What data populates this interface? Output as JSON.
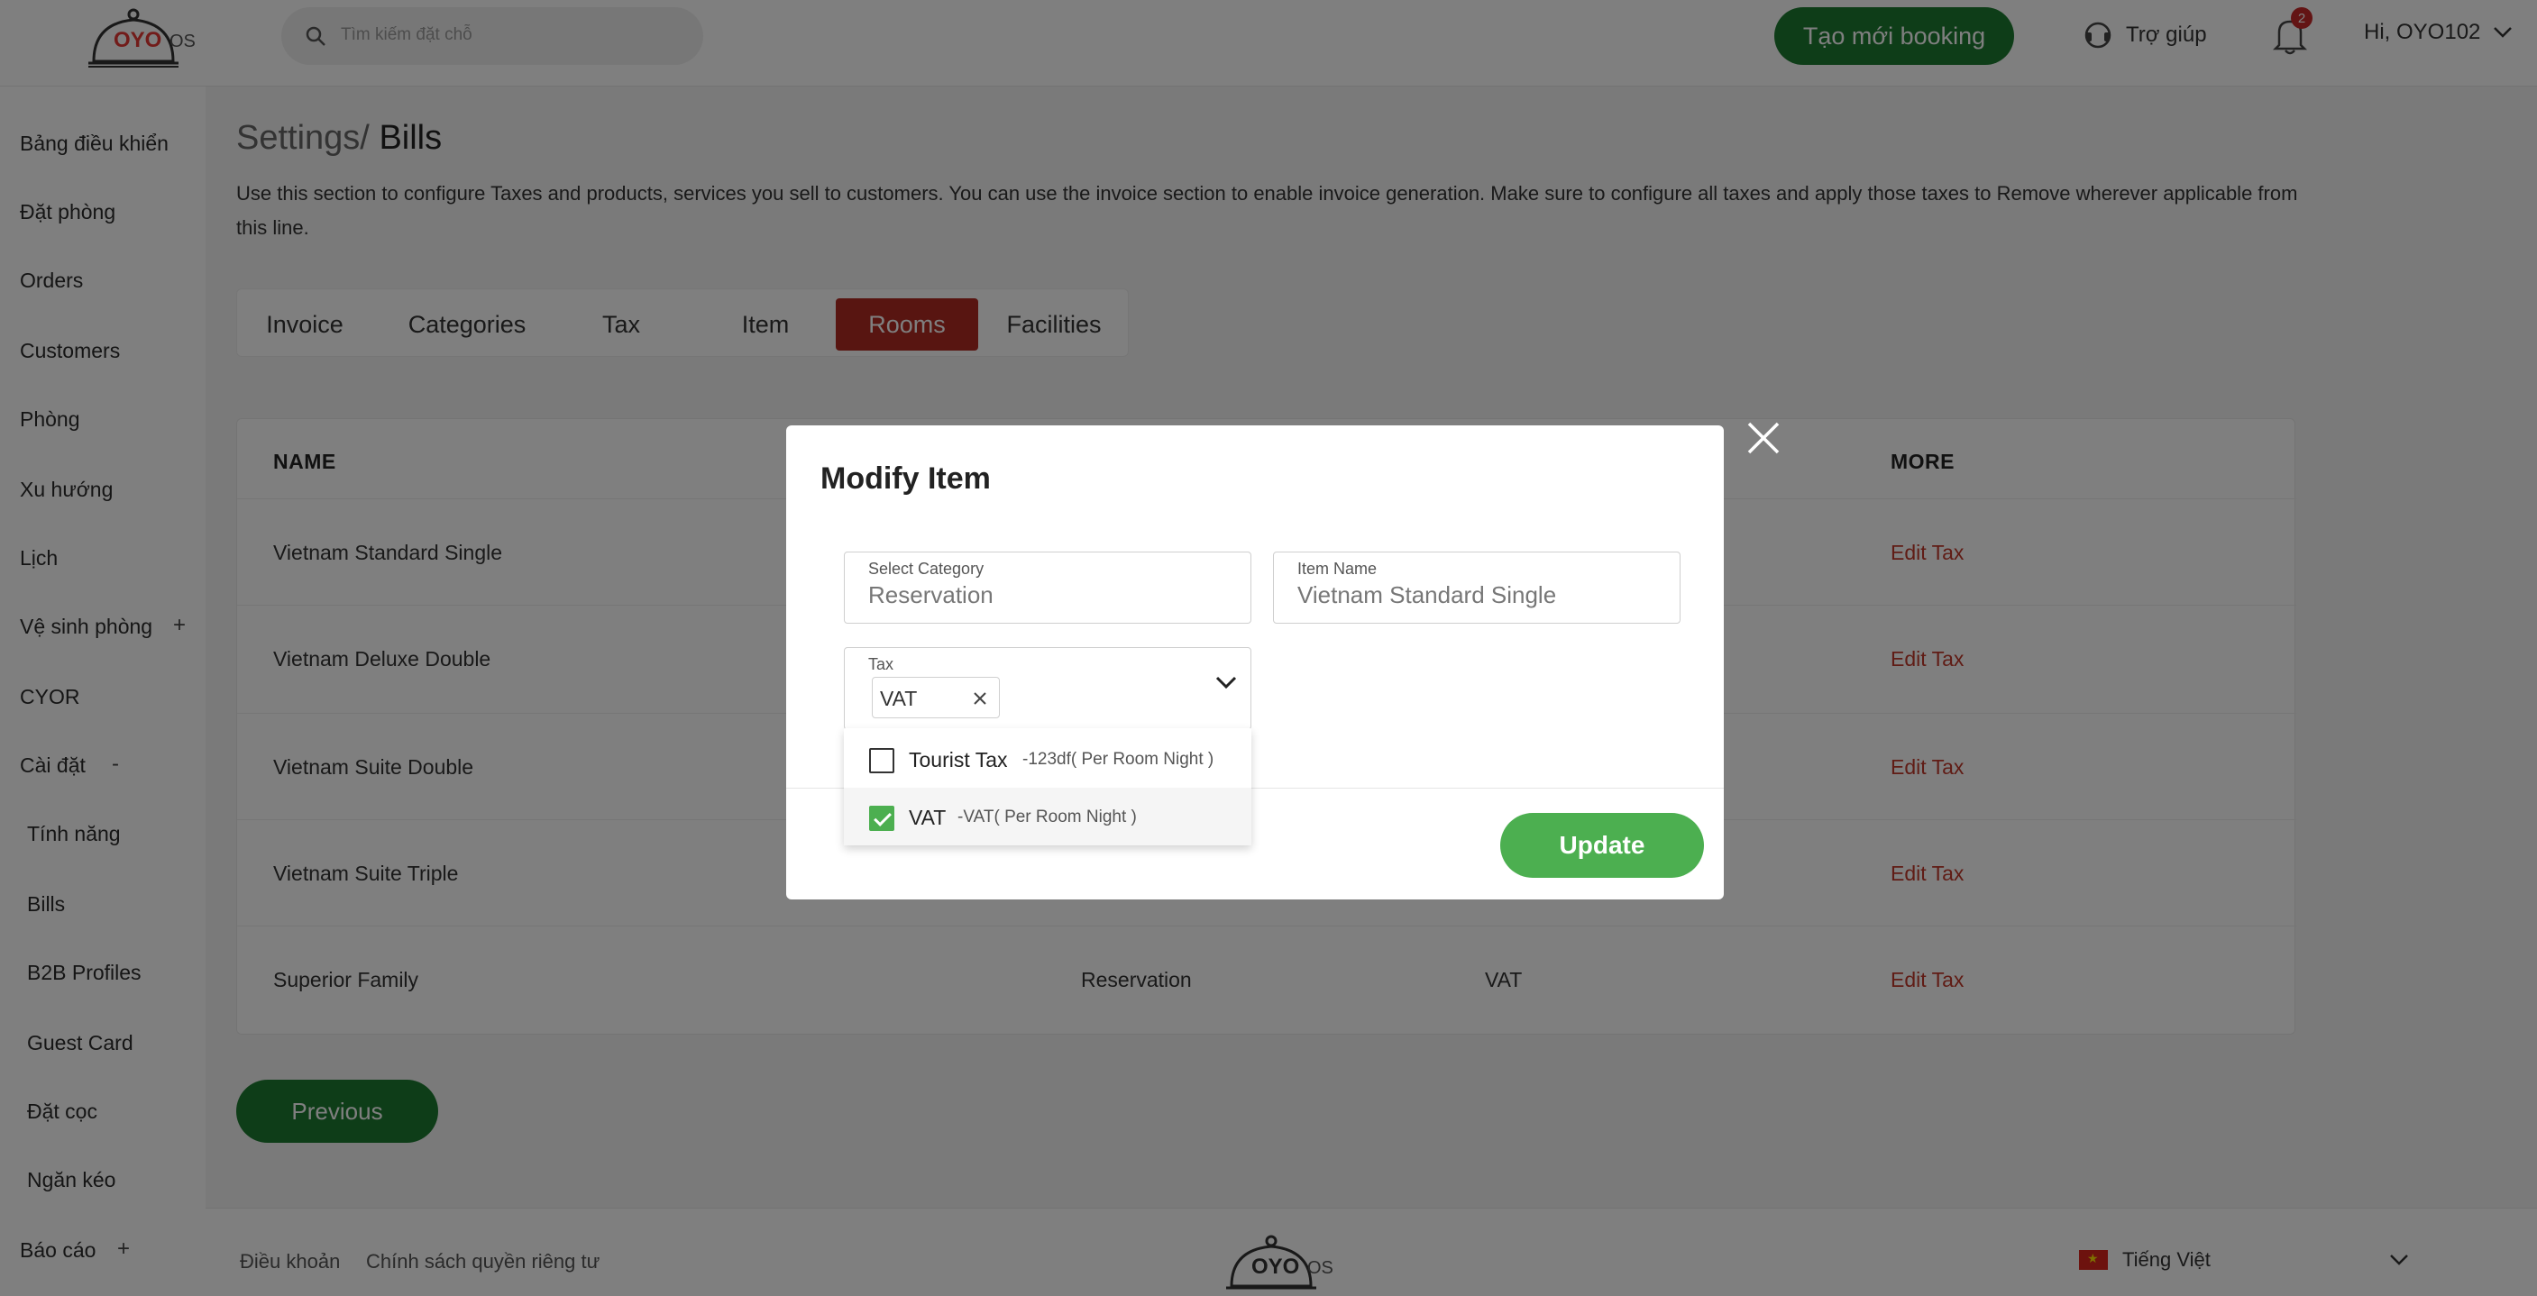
{
  "header": {
    "logo_text": "OYO OS",
    "search_placeholder": "Tìm kiếm đặt chỗ",
    "new_booking_label": "Tạo mới booking",
    "help_label": "Trợ giúp",
    "notification_count": "2",
    "user_greeting": "Hi, OYO102"
  },
  "sidebar": {
    "items": [
      {
        "label": "Bảng điều khiển"
      },
      {
        "label": "Đặt phòng"
      },
      {
        "label": "Orders"
      },
      {
        "label": "Customers"
      },
      {
        "label": "Phòng"
      },
      {
        "label": "Xu hướng"
      },
      {
        "label": "Lịch"
      },
      {
        "label": "Vệ sinh phòng",
        "toggle": "+"
      },
      {
        "label": "CYOR"
      },
      {
        "label": "Cài đặt",
        "toggle": "-"
      },
      {
        "label": "Tính năng"
      },
      {
        "label": "Bills"
      },
      {
        "label": "B2B Profiles"
      },
      {
        "label": "Guest Card"
      },
      {
        "label": "Đặt cọc"
      },
      {
        "label": "Ngăn kéo"
      },
      {
        "label": "Báo cáo",
        "toggle": "+"
      }
    ]
  },
  "page": {
    "breadcrumb_parent": "Settings/",
    "breadcrumb_current": "Bills",
    "description": "Use this section to configure Taxes and products, services you sell to customers. You can use the invoice section to enable invoice generation. Make sure to configure all taxes and apply those taxes to Remove wherever applicable from this line."
  },
  "tabs": [
    {
      "label": "Invoice",
      "active": false
    },
    {
      "label": "Categories",
      "active": false
    },
    {
      "label": "Tax",
      "active": false
    },
    {
      "label": "Item",
      "active": false
    },
    {
      "label": "Rooms",
      "active": true
    },
    {
      "label": "Facilities",
      "active": false
    }
  ],
  "table": {
    "headers": {
      "name": "NAME",
      "more": "MORE"
    },
    "rows": [
      {
        "name": "Vietnam Standard Single",
        "category": "",
        "tax": "",
        "action": "Edit Tax"
      },
      {
        "name": "Vietnam Deluxe Double",
        "category": "",
        "tax": "",
        "action": "Edit Tax"
      },
      {
        "name": "Vietnam Suite Double",
        "category": "",
        "tax": "",
        "action": "Edit Tax"
      },
      {
        "name": "Vietnam Suite Triple",
        "category": "",
        "tax": "",
        "action": "Edit Tax"
      },
      {
        "name": "Superior Family",
        "category": "Reservation",
        "tax": "VAT",
        "action": "Edit Tax"
      }
    ]
  },
  "pagination": {
    "previous_label": "Previous"
  },
  "footer": {
    "terms_label": "Điều khoản",
    "privacy_label": "Chính sách quyền riêng tư",
    "language_label": "Tiếng Việt"
  },
  "modal": {
    "title": "Modify Item",
    "category_label": "Select Category",
    "category_value": "Reservation",
    "item_name_label": "Item Name",
    "item_name_value": "Vietnam Standard Single",
    "tax_label": "Tax",
    "selected_tax_chip": "VAT",
    "update_label": "Update",
    "tax_options": [
      {
        "name": "Tourist Tax",
        "desc": "-123df( Per Room Night )",
        "checked": false
      },
      {
        "name": "VAT",
        "desc": "-VAT( Per Room Night )",
        "checked": true
      }
    ]
  },
  "colors": {
    "brand_green": "#1d7a30",
    "button_green": "#4caf50",
    "active_tab": "#b02a22",
    "link_red": "#c0392b",
    "badge_red": "#c62828"
  }
}
